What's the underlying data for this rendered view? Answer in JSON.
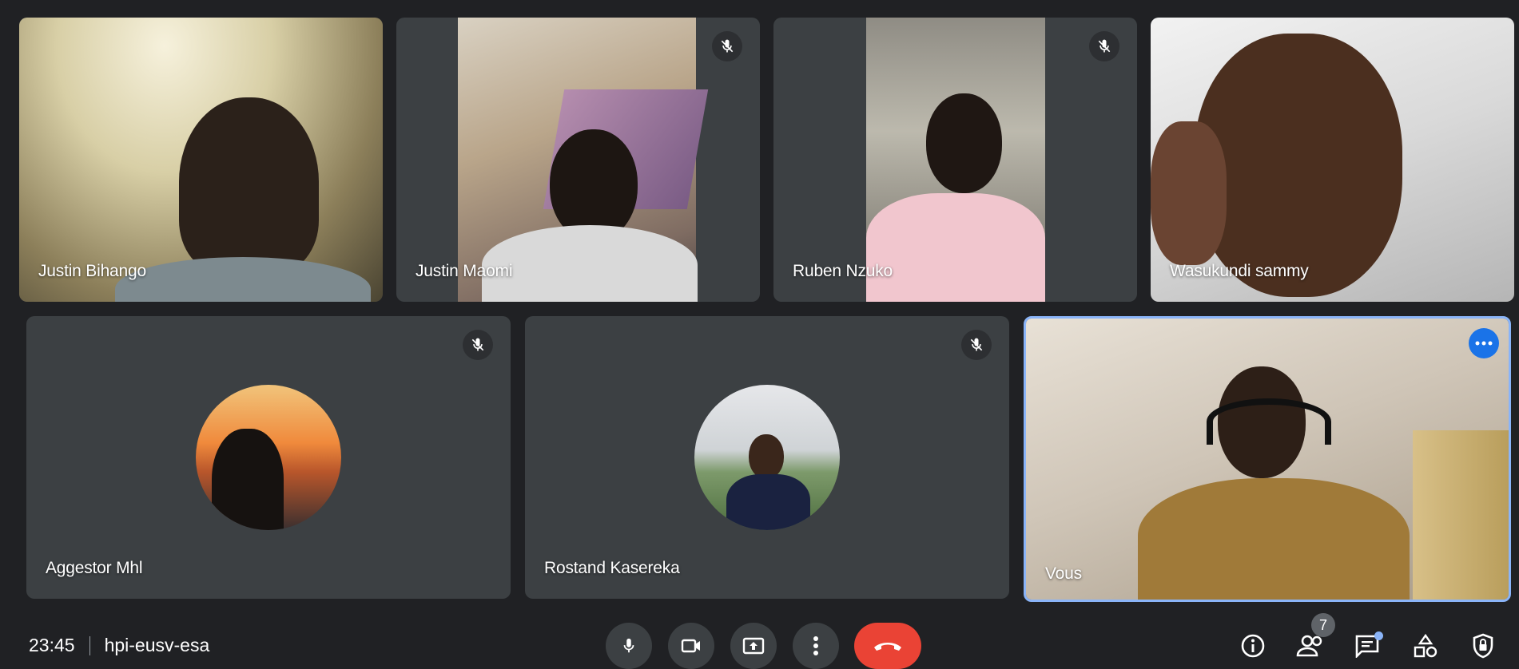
{
  "participants": {
    "p1": {
      "name": "Justin Bihango"
    },
    "p2": {
      "name": "Justin Maomi"
    },
    "p3": {
      "name": "Ruben Nzuko"
    },
    "p4": {
      "name": "Wasukundi sammy"
    },
    "p5": {
      "name": "Aggestor Mhl"
    },
    "p6": {
      "name": "Rostand Kasereka"
    },
    "self": {
      "name": "Vous"
    }
  },
  "meeting": {
    "time": "23:45",
    "code": "hpi-eusv-esa",
    "participant_count": "7"
  },
  "colors": {
    "background": "#202124",
    "tile": "#3c4043",
    "accent": "#1a73e8",
    "end_call": "#ea4335"
  },
  "icons": {
    "mic": "microphone-icon",
    "cam": "camera-icon",
    "present": "present-screen-icon",
    "more": "more-vert-icon",
    "end": "phone-hangup-icon",
    "info": "info-icon",
    "people": "people-icon",
    "chat": "chat-icon",
    "activities": "activities-icon",
    "safety": "shield-lock-icon"
  }
}
